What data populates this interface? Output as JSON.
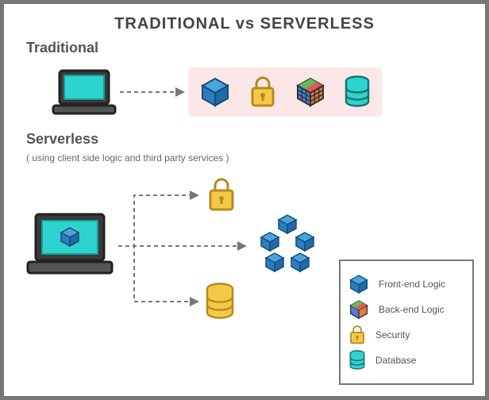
{
  "title": "TRADITIONAL vs SERVERLESS",
  "sections": {
    "traditional": {
      "label": "Traditional"
    },
    "serverless": {
      "label": "Serverless",
      "subtitle": "( using client side logic and third party services )"
    }
  },
  "legend": {
    "frontend": "Front-end Logic",
    "backend": "Back-end Logic",
    "security": "Security",
    "database": "Database"
  }
}
